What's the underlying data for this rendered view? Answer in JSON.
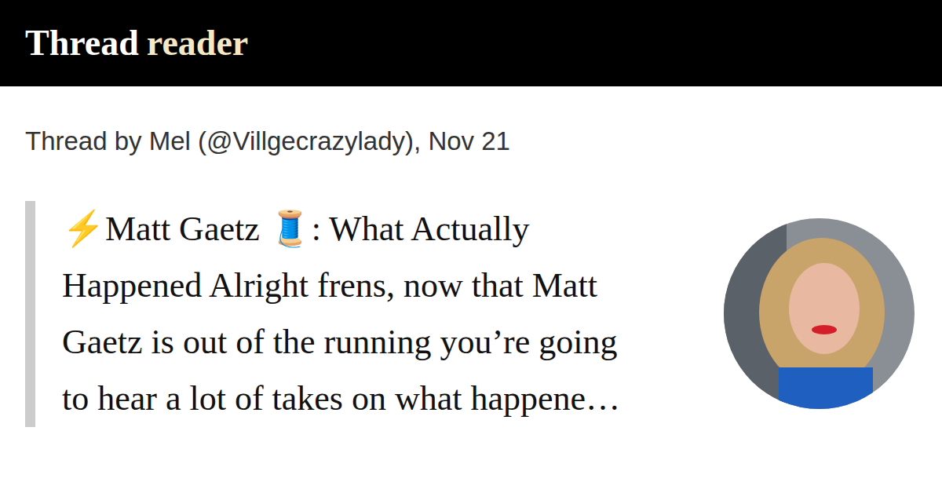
{
  "header": {
    "logo": {
      "first": "Thread",
      "second": "reader"
    }
  },
  "thread": {
    "byline": "Thread by Mel (@Villgecrazylady), Nov 21",
    "quote_lines": [
      "⚡Matt Gaetz 🧵: What Actually",
      "Happened Alright frens, now that Matt",
      "Gaetz is out of the running you’re going",
      "to hear a lot of takes on what happene…"
    ]
  }
}
